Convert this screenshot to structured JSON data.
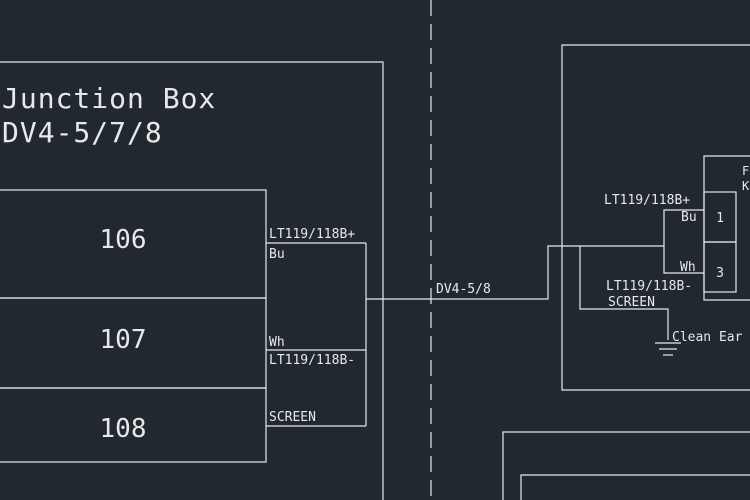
{
  "junction_box": {
    "title_line1": "Junction Box",
    "title_line2": "DV4-5/7/8",
    "terminals": [
      "106",
      "107",
      "108"
    ],
    "labels": {
      "pos_cable": "LT119/118B+",
      "pos_core": "Bu",
      "neg_core": "Wh",
      "neg_cable": "LT119/118B-",
      "screen": "SCREEN"
    }
  },
  "cable": {
    "label": "DV4-5/8"
  },
  "field_device": {
    "pos_cable": "LT119/118B+",
    "pos_core": "Bu",
    "neg_core": "Wh",
    "neg_cable": "LT119/118B-",
    "screen": "SCREEN",
    "terminal_top": "1",
    "terminal_bottom": "3",
    "earth_label": "Clean Ear",
    "box_label_1": "F",
    "box_label_2": "K"
  }
}
